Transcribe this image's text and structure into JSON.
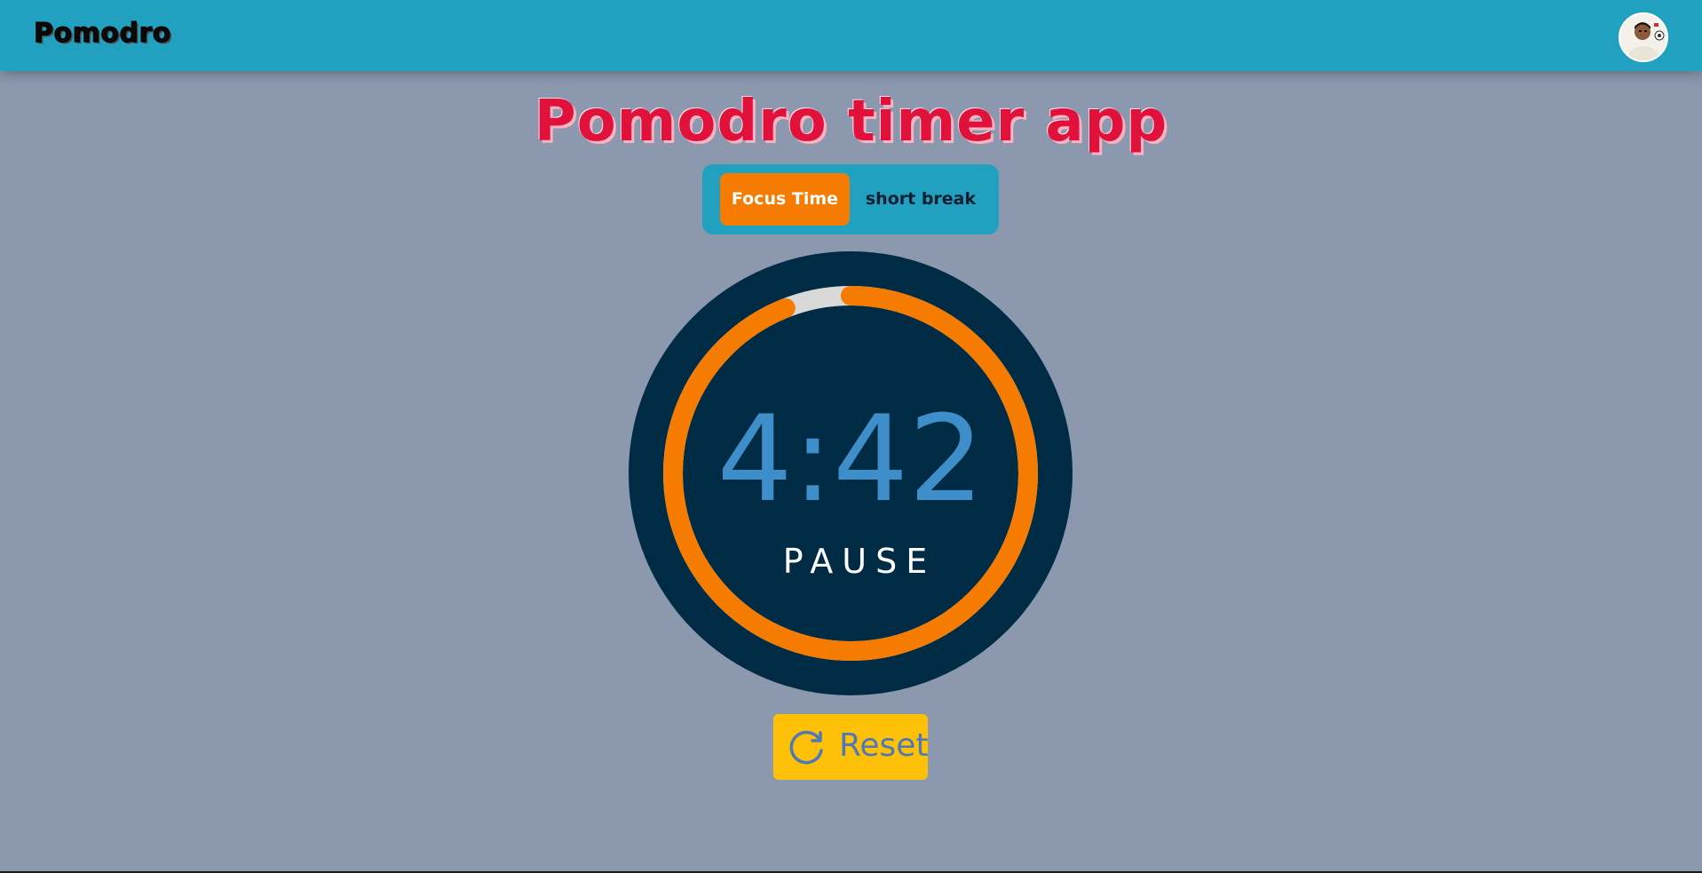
{
  "navbar": {
    "brand": "Pomodro",
    "avatar_icon": "user-avatar"
  },
  "page": {
    "title": "Pomodro timer app"
  },
  "modes": {
    "focus_label": "Focus Time",
    "break_label": "short break",
    "active": "focus"
  },
  "timer": {
    "time": "4:42",
    "control_label": "PAUSE",
    "progress_fraction": 0.94
  },
  "reset": {
    "label": "Reset",
    "icon": "reset-icon"
  },
  "colors": {
    "background": "#8c98ae",
    "navbar": "#22a0bf",
    "accent": "#f57c00",
    "title": "#e0123c",
    "timer_bg": "#002b45",
    "time_text": "#3e8fc9",
    "reset_bg": "#ffc107"
  }
}
